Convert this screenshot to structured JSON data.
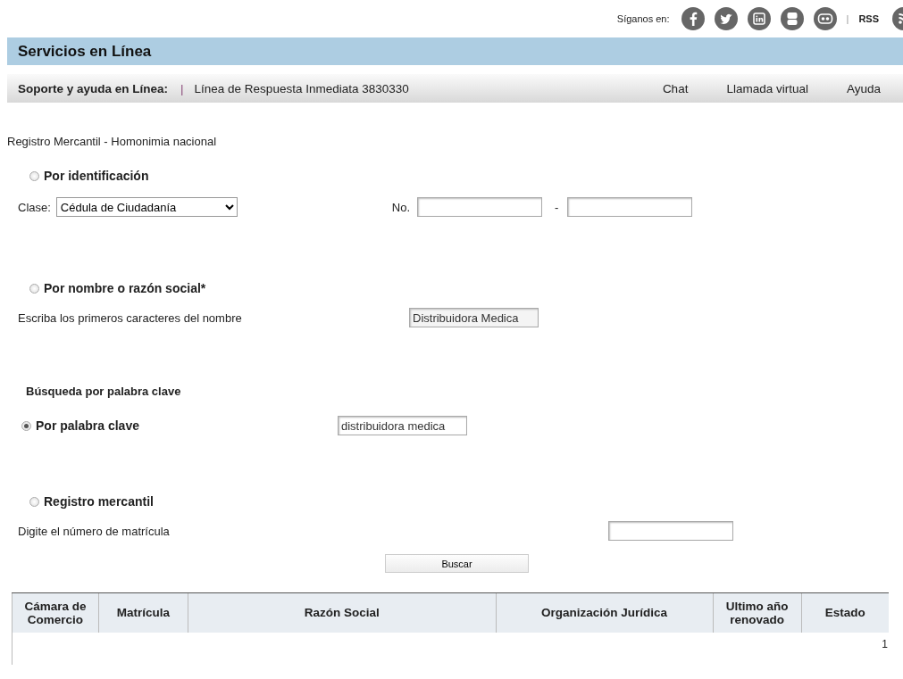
{
  "social": {
    "label": "Síganos en:",
    "separator": "|",
    "rss": "RSS"
  },
  "title": "Servicios en Línea",
  "support": {
    "label": "Soporte y ayuda en Línea:",
    "separator": "|",
    "phone": "Línea de Respuesta Inmediata 3830330",
    "links": [
      "Chat",
      "Llamada virtual",
      "Ayuda"
    ]
  },
  "form": {
    "heading": "Registro Mercantil - Homonimia nacional",
    "by_id": {
      "label": "Por identificación",
      "selected": false,
      "class_label": "Clase:",
      "class_value": "Cédula de Ciudadanía",
      "no_label": "No.",
      "dash": "-"
    },
    "by_name": {
      "label": "Por nombre o razón social*",
      "selected": false,
      "hint": "Escriba los primeros caracteres del nombre",
      "value": "Distribuidora Medica"
    },
    "keyword_heading": "Búsqueda por palabra clave",
    "by_keyword": {
      "label": "Por palabra clave",
      "selected": true,
      "value": "distribuidora medica"
    },
    "by_registry": {
      "label": "Registro mercantil",
      "selected": false,
      "hint": "Digite el número de matrícula"
    },
    "search_button": "Buscar"
  },
  "table": {
    "columns": [
      "Cámara de Comercio",
      "Matrícula",
      "Razón Social",
      "Organización Jurídica",
      "Ultimo año renovado",
      "Estado"
    ],
    "page": "1"
  }
}
